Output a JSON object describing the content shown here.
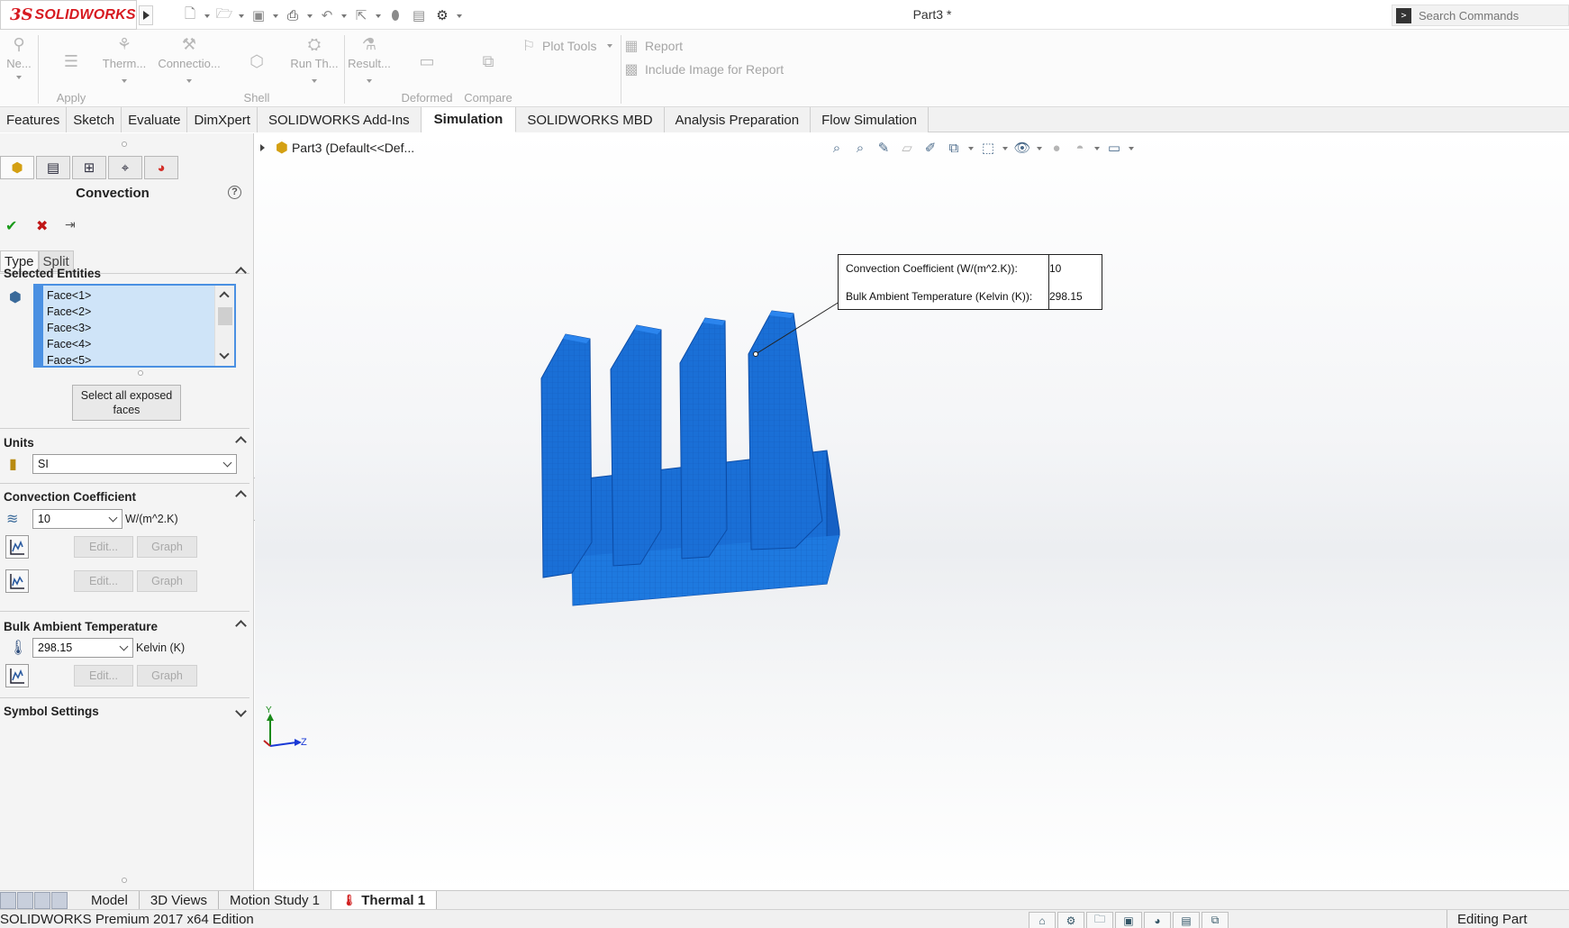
{
  "app": {
    "brand": "SOLIDWORKS",
    "brand_mark": "3S",
    "document_title": "Part3 *",
    "search_placeholder": "Search Commands"
  },
  "ribbon": {
    "buttons": [
      {
        "id": "new",
        "label": "Ne...",
        "icon": "new-study-icon"
      },
      {
        "id": "apply-material",
        "label": "Apply\nMaterial",
        "icon": "apply-material-icon"
      },
      {
        "id": "thermal-loads",
        "label": "Therm...",
        "icon": "thermal-loads-icon"
      },
      {
        "id": "connections",
        "label": "Connectio...",
        "icon": "connections-icon"
      },
      {
        "id": "shell-manager",
        "label": "Shell\nManager",
        "icon": "shell-manager-icon"
      },
      {
        "id": "run",
        "label": "Run Th...",
        "icon": "run-icon"
      },
      {
        "id": "results",
        "label": "Result...",
        "icon": "results-icon"
      },
      {
        "id": "deformed-result",
        "label": "Deformed\nResult",
        "icon": "deformed-result-icon"
      },
      {
        "id": "compare-results",
        "label": "Compare\nResults",
        "icon": "compare-results-icon"
      }
    ],
    "plot_tools": "Plot Tools",
    "report": "Report",
    "include_image": "Include Image for Report"
  },
  "command_tabs": [
    {
      "label": "Features",
      "active": false
    },
    {
      "label": "Sketch",
      "active": false
    },
    {
      "label": "Evaluate",
      "active": false
    },
    {
      "label": "DimXpert",
      "active": false
    },
    {
      "label": "SOLIDWORKS Add-Ins",
      "active": false
    },
    {
      "label": "Simulation",
      "active": true
    },
    {
      "label": "SOLIDWORKS MBD",
      "active": false
    },
    {
      "label": "Analysis Preparation",
      "active": false
    },
    {
      "label": "Flow Simulation",
      "active": false
    }
  ],
  "property_manager": {
    "title": "Convection",
    "help": "?",
    "subtabs": [
      "Type",
      "Split"
    ],
    "selected_entities": {
      "title": "Selected Entities",
      "faces": [
        "Face<1>",
        "Face<2>",
        "Face<3>",
        "Face<4>",
        "Face<5>"
      ],
      "select_all_button": "Select all exposed faces"
    },
    "units": {
      "title": "Units",
      "value": "SI"
    },
    "convection_coefficient": {
      "title": "Convection Coefficient",
      "value": "10",
      "unit": "W/(m^2.K)",
      "edit": "Edit...",
      "graph": "Graph"
    },
    "bulk_ambient_temperature": {
      "title": "Bulk Ambient Temperature",
      "value": "298.15",
      "unit": "Kelvin (K)",
      "edit": "Edit...",
      "graph": "Graph"
    },
    "symbol_settings": "Symbol Settings"
  },
  "viewport": {
    "tree_label": "Part3  (Default<<Def...",
    "callout": {
      "coef_label": "Convection Coefficient (W/(m^2.K)):",
      "coef_value": "10",
      "temp_label": "Bulk Ambient Temperature (Kelvin (K)):",
      "temp_value": "298.15"
    },
    "axes": {
      "y": "Y",
      "z": "Z"
    },
    "model_color": "#1a6fd6"
  },
  "bottom_tabs": [
    {
      "label": "Model",
      "active": false
    },
    {
      "label": "3D Views",
      "active": false
    },
    {
      "label": "Motion Study 1",
      "active": false
    },
    {
      "label": "Thermal 1",
      "active": true
    }
  ],
  "status": {
    "edition": "SOLIDWORKS Premium 2017 x64 Edition",
    "mode": "Editing Part"
  }
}
